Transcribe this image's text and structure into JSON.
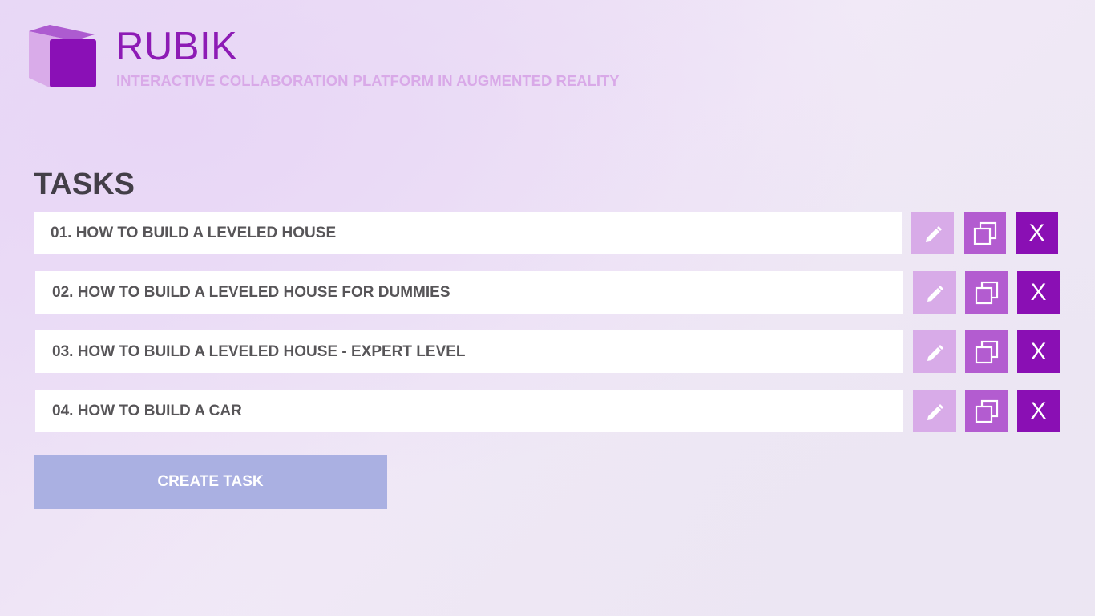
{
  "header": {
    "title": "RUBIK",
    "subtitle": "INTERACTIVE COLLABORATION PLATFORM IN AUGMENTED REALITY",
    "logo_icon": "cube-icon"
  },
  "tasks_section": {
    "heading": "TASKS",
    "tasks": [
      {
        "label": "01. HOW TO BUILD A LEVELED HOUSE"
      },
      {
        "label": "02. HOW TO BUILD A LEVELED HOUSE FOR DUMMIES"
      },
      {
        "label": "03. HOW TO BUILD A LEVELED HOUSE - EXPERT LEVEL"
      },
      {
        "label": "04. HOW TO BUILD A CAR"
      }
    ],
    "delete_label": "X",
    "edit_icon": "pencil-icon",
    "copy_icon": "copy-icon",
    "create_button_label": "CREATE TASK"
  },
  "colors": {
    "accent": "#8a0fb4",
    "edit_button": "#d8abe8",
    "copy_button": "#b35cd0",
    "create_button": "#aab0e2",
    "subtitle": "#d9a9e8",
    "heading": "#433f48"
  }
}
